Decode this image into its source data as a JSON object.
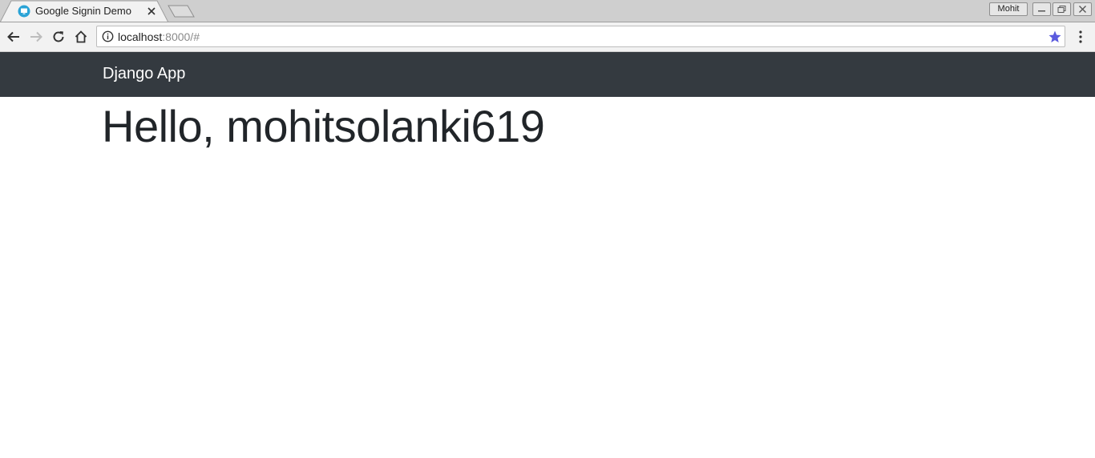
{
  "browser": {
    "tab": {
      "title": "Google Signin Demo",
      "favicon": "monitor-icon"
    },
    "profile_label": "Mohit",
    "window_controls": [
      "minimize-icon",
      "restore-icon",
      "close-icon"
    ],
    "toolbar": {
      "icons": [
        "back-arrow-icon",
        "forward-arrow-icon",
        "reload-icon",
        "home-icon"
      ],
      "url_host": "localhost",
      "url_rest": ":8000/#",
      "bookmark_star_color": "#5b5bde"
    }
  },
  "page": {
    "navbar": {
      "brand": "Django App",
      "background": "#343a40"
    },
    "greeting": "Hello, mohitsolanki619"
  }
}
